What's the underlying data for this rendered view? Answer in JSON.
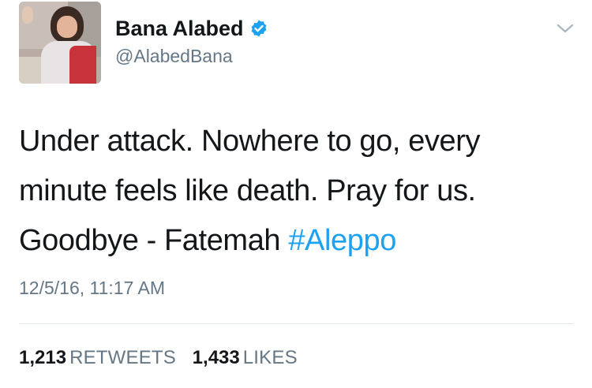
{
  "user": {
    "name": "Bana Alabed",
    "handle": "@AlabedBana",
    "verified": true,
    "avatar_icon": "profile-photo"
  },
  "tweet": {
    "lines": [
      "Under attack. Nowhere to go, every",
      "minute feels like death. Pray for us.",
      "Goodbye - Fatemah "
    ],
    "hashtag": "#Aleppo",
    "timestamp": "12/5/16, 11:17 AM"
  },
  "stats": {
    "retweets_count": "1,213",
    "retweets_label": "RETWEETS",
    "likes_count": "1,433",
    "likes_label": "LIKES"
  },
  "colors": {
    "link": "#1da1f2",
    "secondary_text": "#657786",
    "primary_text": "#14171a",
    "divider": "#e1e8ed"
  },
  "icons": {
    "verified": "verified-badge-icon",
    "menu": "chevron-down-icon"
  }
}
